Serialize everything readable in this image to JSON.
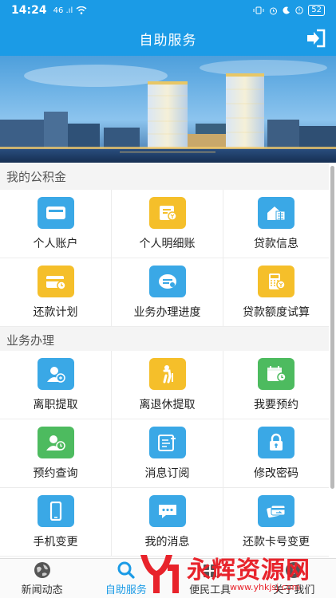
{
  "status_bar": {
    "time": "14:24",
    "signal_text": "46 .ıl",
    "battery": "52"
  },
  "header": {
    "title": "自助服务",
    "logout_icon": "logout-icon"
  },
  "sections": [
    {
      "title": "我的公积金",
      "items": [
        {
          "label": "个人账户",
          "icon": "wallet-icon",
          "color": "#3aa8e6"
        },
        {
          "label": "个人明细账",
          "icon": "bill-icon",
          "color": "#f5bf2a"
        },
        {
          "label": "贷款信息",
          "icon": "house-icon",
          "color": "#3aa8e6"
        },
        {
          "label": "还款计划",
          "icon": "card-plan-icon",
          "color": "#f5bf2a"
        },
        {
          "label": "业务办理进度",
          "icon": "progress-icon",
          "color": "#3aa8e6"
        },
        {
          "label": "贷款额度试算",
          "icon": "calculator-icon",
          "color": "#f5bf2a"
        }
      ]
    },
    {
      "title": "业务办理",
      "items": [
        {
          "label": "离职提取",
          "icon": "user-leave-icon",
          "color": "#3aa8e6"
        },
        {
          "label": "离退休提取",
          "icon": "elder-icon",
          "color": "#f5bf2a"
        },
        {
          "label": "我要预约",
          "icon": "calendar-clock-icon",
          "color": "#4dbb5f"
        },
        {
          "label": "预约查询",
          "icon": "user-clock-icon",
          "color": "#4dbb5f"
        },
        {
          "label": "消息订阅",
          "icon": "subscribe-icon",
          "color": "#3aa8e6"
        },
        {
          "label": "修改密码",
          "icon": "lock-icon",
          "color": "#3aa8e6"
        },
        {
          "label": "手机变更",
          "icon": "phone-icon",
          "color": "#3aa8e6"
        },
        {
          "label": "我的消息",
          "icon": "message-icon",
          "color": "#3aa8e6"
        },
        {
          "label": "还款卡号变更",
          "icon": "card-change-icon",
          "color": "#3aa8e6"
        }
      ]
    }
  ],
  "bottom_nav": [
    {
      "label": "新闻动态",
      "icon": "globe-icon",
      "active": false
    },
    {
      "label": "自助服务",
      "icon": "search-icon",
      "active": true
    },
    {
      "label": "便民工具",
      "icon": "tools-icon",
      "active": false
    },
    {
      "label": "关于我们",
      "icon": "about-icon",
      "active": false
    }
  ],
  "watermark": {
    "text": "永辉资源网",
    "url": "www.yhkjsj.com"
  },
  "colors": {
    "primary": "#1b9be6",
    "blue_icon": "#3aa8e6",
    "yellow_icon": "#f5bf2a",
    "green_icon": "#4dbb5f",
    "watermark_red": "#e8232b"
  }
}
